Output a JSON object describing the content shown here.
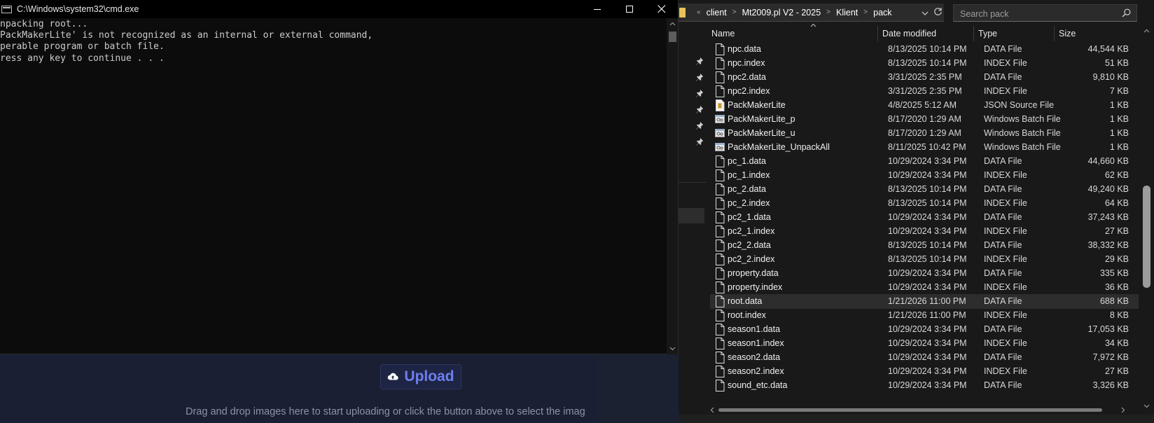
{
  "webpage": {
    "upload_label": "Upload",
    "drop_hint": "Drag and drop images here to start uploading or click the button above to select the imag"
  },
  "cmd": {
    "title": "C:\\Windows\\system32\\cmd.exe",
    "output": "npacking root...\nPackMakerLite' is not recognized as an internal or external command,\nperable program or batch file.\nress any key to continue . . ."
  },
  "explorer": {
    "breadcrumbs": [
      "client",
      "Mt2009.pl V2 - 2025",
      "Klient",
      "pack"
    ],
    "search_placeholder": "Search pack",
    "columns": {
      "name": "Name",
      "date": "Date modified",
      "type": "Type",
      "size": "Size"
    },
    "files": [
      {
        "name": "npc.data",
        "date": "8/13/2025 10:14 PM",
        "type": "DATA File",
        "size": "44,544 KB",
        "icon": "file-icon"
      },
      {
        "name": "npc.index",
        "date": "8/13/2025 10:14 PM",
        "type": "INDEX File",
        "size": "51 KB",
        "icon": "file-icon"
      },
      {
        "name": "npc2.data",
        "date": "3/31/2025 2:35 PM",
        "type": "DATA File",
        "size": "9,810 KB",
        "icon": "file-icon"
      },
      {
        "name": "npc2.index",
        "date": "3/31/2025 2:35 PM",
        "type": "INDEX File",
        "size": "7 KB",
        "icon": "file-icon"
      },
      {
        "name": "PackMakerLite",
        "date": "4/8/2025 5:12 AM",
        "type": "JSON Source File",
        "size": "1 KB",
        "icon": "json-file-icon"
      },
      {
        "name": "PackMakerLite_p",
        "date": "8/17/2020 1:29 AM",
        "type": "Windows Batch File",
        "size": "1 KB",
        "icon": "batch-file-icon"
      },
      {
        "name": "PackMakerLite_u",
        "date": "8/17/2020 1:29 AM",
        "type": "Windows Batch File",
        "size": "1 KB",
        "icon": "batch-file-icon"
      },
      {
        "name": "PackMakerLite_UnpackAll",
        "date": "8/11/2025 10:42 PM",
        "type": "Windows Batch File",
        "size": "1 KB",
        "icon": "batch-file-icon"
      },
      {
        "name": "pc_1.data",
        "date": "10/29/2024 3:34 PM",
        "type": "DATA File",
        "size": "44,660 KB",
        "icon": "file-icon"
      },
      {
        "name": "pc_1.index",
        "date": "10/29/2024 3:34 PM",
        "type": "INDEX File",
        "size": "62 KB",
        "icon": "file-icon"
      },
      {
        "name": "pc_2.data",
        "date": "8/13/2025 10:14 PM",
        "type": "DATA File",
        "size": "49,240 KB",
        "icon": "file-icon"
      },
      {
        "name": "pc_2.index",
        "date": "8/13/2025 10:14 PM",
        "type": "INDEX File",
        "size": "64 KB",
        "icon": "file-icon"
      },
      {
        "name": "pc2_1.data",
        "date": "10/29/2024 3:34 PM",
        "type": "DATA File",
        "size": "37,243 KB",
        "icon": "file-icon"
      },
      {
        "name": "pc2_1.index",
        "date": "10/29/2024 3:34 PM",
        "type": "INDEX File",
        "size": "27 KB",
        "icon": "file-icon"
      },
      {
        "name": "pc2_2.data",
        "date": "8/13/2025 10:14 PM",
        "type": "DATA File",
        "size": "38,332 KB",
        "icon": "file-icon"
      },
      {
        "name": "pc2_2.index",
        "date": "8/13/2025 10:14 PM",
        "type": "INDEX File",
        "size": "29 KB",
        "icon": "file-icon"
      },
      {
        "name": "property.data",
        "date": "10/29/2024 3:34 PM",
        "type": "DATA File",
        "size": "335 KB",
        "icon": "file-icon"
      },
      {
        "name": "property.index",
        "date": "10/29/2024 3:34 PM",
        "type": "INDEX File",
        "size": "36 KB",
        "icon": "file-icon"
      },
      {
        "name": "root.data",
        "date": "1/21/2026 11:00 PM",
        "type": "DATA File",
        "size": "688 KB",
        "icon": "file-icon",
        "selected": true
      },
      {
        "name": "root.index",
        "date": "1/21/2026 11:00 PM",
        "type": "INDEX File",
        "size": "8 KB",
        "icon": "file-icon"
      },
      {
        "name": "season1.data",
        "date": "10/29/2024 3:34 PM",
        "type": "DATA File",
        "size": "17,053 KB",
        "icon": "file-icon"
      },
      {
        "name": "season1.index",
        "date": "10/29/2024 3:34 PM",
        "type": "INDEX File",
        "size": "34 KB",
        "icon": "file-icon"
      },
      {
        "name": "season2.data",
        "date": "10/29/2024 3:34 PM",
        "type": "DATA File",
        "size": "7,972 KB",
        "icon": "file-icon"
      },
      {
        "name": "season2.index",
        "date": "10/29/2024 3:34 PM",
        "type": "INDEX File",
        "size": "27 KB",
        "icon": "file-icon"
      },
      {
        "name": "sound_etc.data",
        "date": "10/29/2024 3:34 PM",
        "type": "DATA File",
        "size": "3,326 KB",
        "icon": "file-icon"
      }
    ]
  },
  "colors": {
    "cmd_bg": "#0c0c0c",
    "explorer_bg": "#191919",
    "selected_row": "#2d2d2d",
    "upload_accent": "#6e7ff0",
    "folder": "#e8c158"
  }
}
